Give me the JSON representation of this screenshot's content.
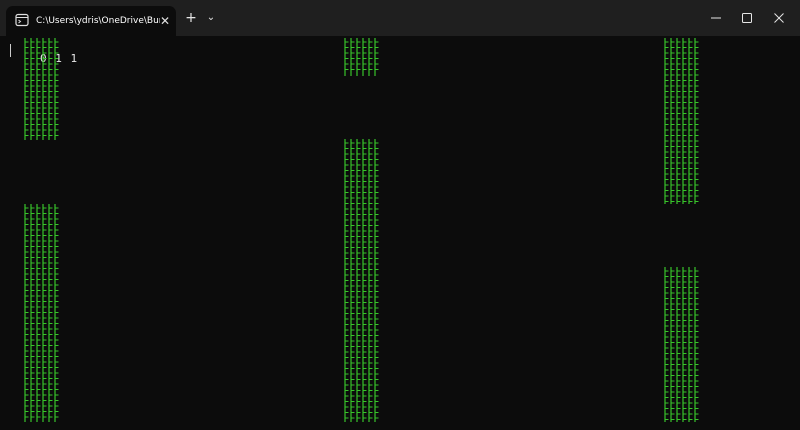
{
  "window": {
    "tab_title": "C:\\Users\\ydris\\OneDrive\\Bureau",
    "tab_close": "✕",
    "new_tab": "+",
    "dropdown": "⌄"
  },
  "terminal": {
    "score_text": "0 1 1",
    "pipe_glyph": "├",
    "pipe_color": "#38c42a"
  }
}
